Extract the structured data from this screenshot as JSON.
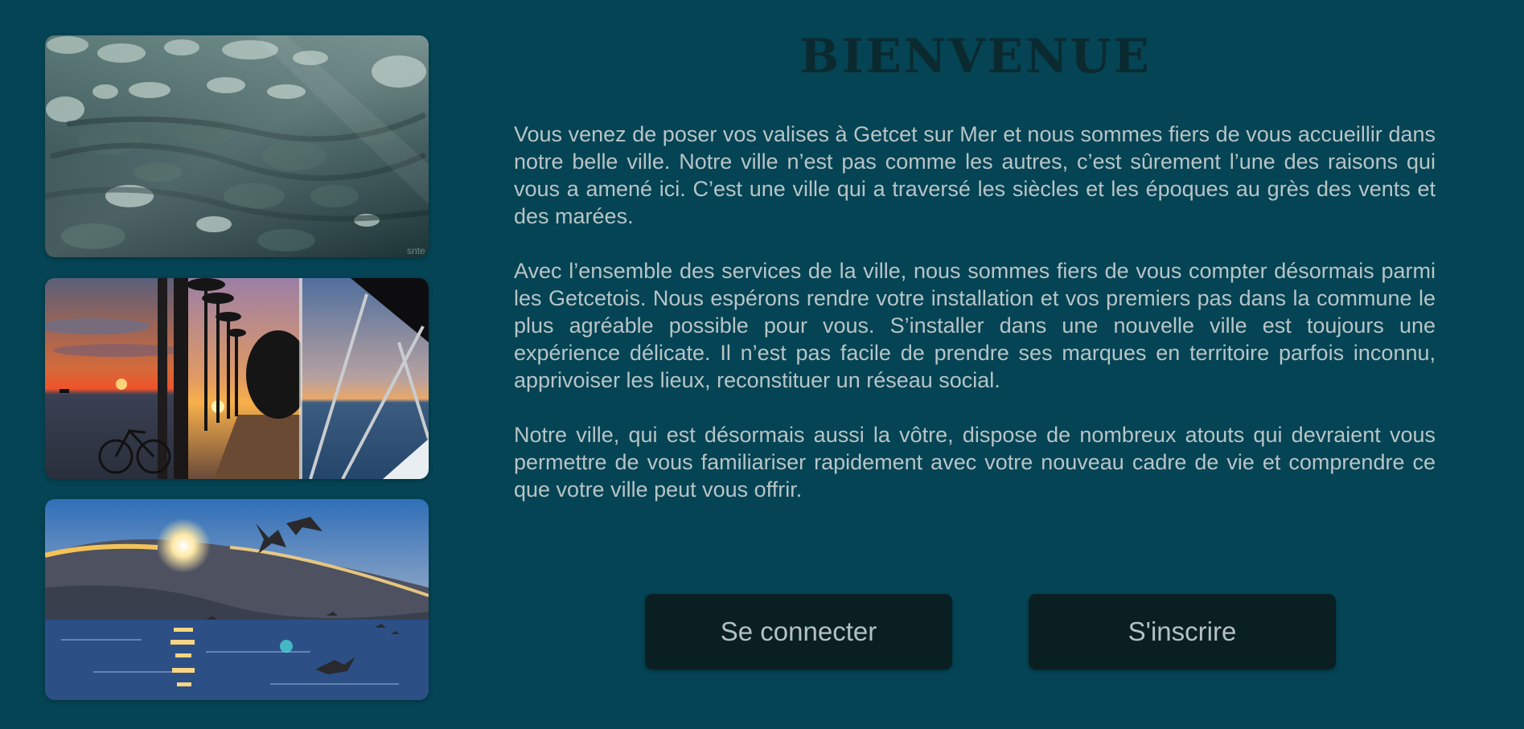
{
  "welcome": {
    "title": "BIENVENUE",
    "paragraphs": [
      "Vous venez de poser vos valises à Getcet sur Mer et nous sommes fiers de vous accueillir dans notre belle ville. Notre ville n’est pas comme les autres, c’est sûrement l’une des raisons qui vous a amené ici. C’est une ville qui a traversé les siècles et les époques au grès des vents et des marées.",
      "Avec l’ensemble des services de la ville, nous sommes fiers de vous compter désormais parmi les Getcetois. Nous espérons rendre votre installation et vos premiers pas dans la commune le plus agréable possible pour vous. S’installer dans une nouvelle ville est toujours une expérience délicate. Il n’est pas facile de prendre ses marques en territoire parfois inconnu, apprivoiser les lieux, reconstituer un réseau social.",
      "Notre ville, qui est désormais aussi la vôtre, dispose de nombreux atouts qui devraient vous permettre de vous familiariser rapidement avec votre nouveau cadre de vie et comprendre ce que votre ville peut vous offrir."
    ]
  },
  "actions": {
    "login_label": "Se connecter",
    "signup_label": "S'inscrire"
  },
  "photos": {
    "watermark": "snte"
  },
  "colors": {
    "background": "#044454",
    "title": "#0b2a30",
    "text": "#b8c4c6",
    "button_bg": "#0a1f22",
    "button_text": "#b4c0c2"
  }
}
